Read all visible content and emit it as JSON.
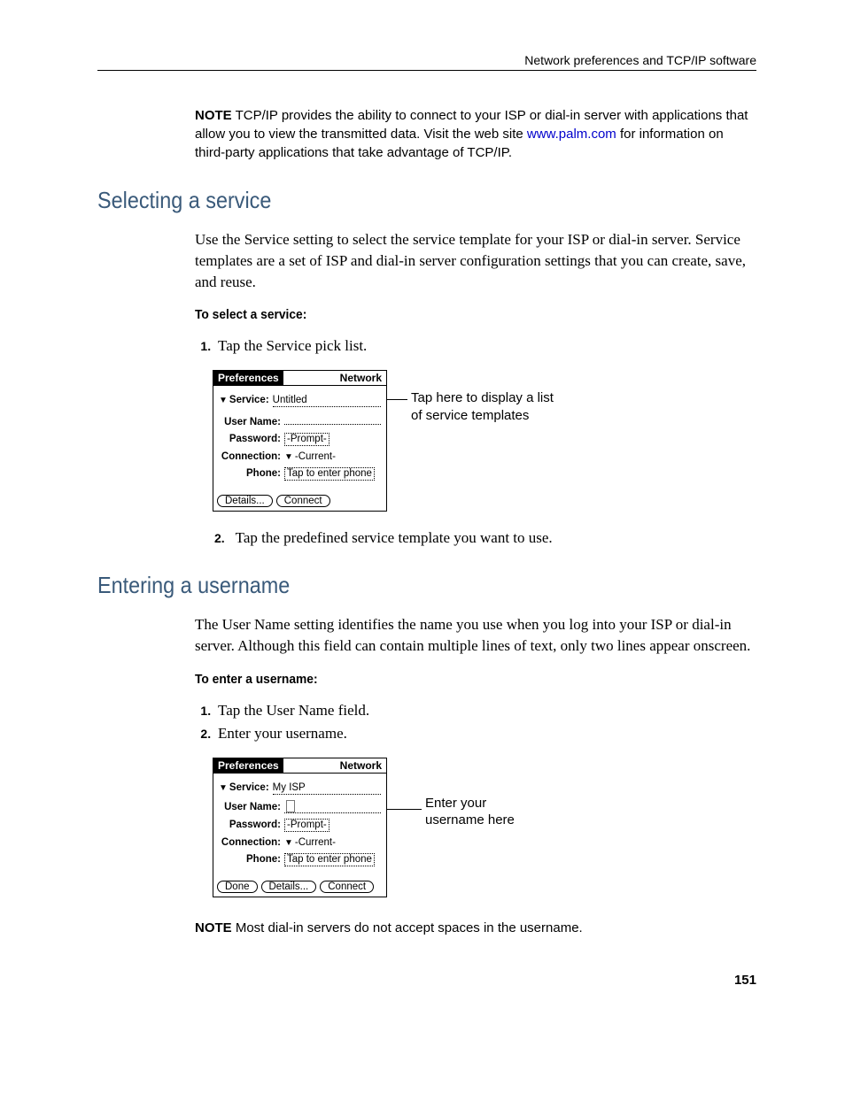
{
  "header": {
    "right": "Network preferences and TCP/IP software"
  },
  "note1": {
    "label": "NOTE",
    "text_part1": "TCP/IP provides the ability to connect to your ISP or dial-in server with applications that allow you to view the transmitted data. Visit the web site ",
    "link": "www.palm.com",
    "text_part2": " for information on third-party applications that take advantage of TCP/IP."
  },
  "section1": {
    "heading": "Selecting a service",
    "body": "Use the Service setting to select the service template for your ISP or dial-in server. Service templates are a set of ISP and dial-in server configuration settings that you can create, save, and reuse.",
    "subhead": "To select a service:",
    "step1": "Tap the Service pick list.",
    "step2_num": "2.",
    "step2": "Tap the predefined service template you want to use."
  },
  "fig1": {
    "title_left": "Preferences",
    "title_right": "Network",
    "rows": {
      "service_label": "Service:",
      "service_value": "Untitled",
      "user_label": "User Name:",
      "user_value": "",
      "password_label": "Password:",
      "password_value": "-Prompt-",
      "connection_label": "Connection:",
      "connection_value": "-Current-",
      "phone_label": "Phone:",
      "phone_value": "Tap to enter phone"
    },
    "buttons": {
      "details": "Details...",
      "connect": "Connect"
    },
    "callout": "Tap here to display a list of service templates"
  },
  "section2": {
    "heading": "Entering a username",
    "body": "The User Name setting identifies the name you use when you log into your ISP or dial-in server. Although this field can contain multiple lines of text, only two lines appear onscreen.",
    "subhead": "To enter a username:",
    "step1": "Tap the User Name field.",
    "step2": "Enter your username."
  },
  "fig2": {
    "title_left": "Preferences",
    "title_right": "Network",
    "rows": {
      "service_label": "Service:",
      "service_value": "My ISP",
      "user_label": "User Name:",
      "user_value": "",
      "password_label": "Password:",
      "password_value": "-Prompt-",
      "connection_label": "Connection:",
      "connection_value": "-Current-",
      "phone_label": "Phone:",
      "phone_value": "Tap to enter phone"
    },
    "buttons": {
      "done": "Done",
      "details": "Details...",
      "connect": "Connect"
    },
    "callout": "Enter your username here"
  },
  "note2": {
    "label": "NOTE",
    "text": "Most dial-in servers do not accept spaces in the username."
  },
  "page_number": "151"
}
